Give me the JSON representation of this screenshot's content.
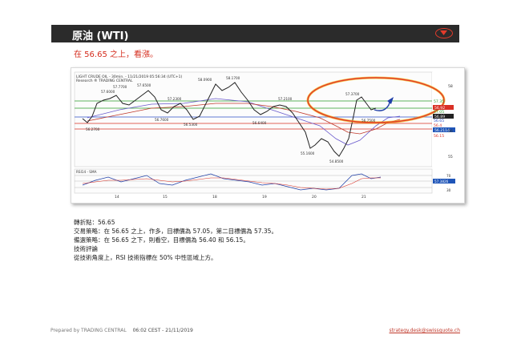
{
  "header": {
    "title": "原油 (WTI)",
    "toggle_icon": "chevron-down-icon"
  },
  "headline": "在 56.65 之上，看漲。",
  "chart": {
    "title_line1": "LIGHT CRUDE OIL - 30min. - 11/21/2019 05:56:34 (UTC+1)",
    "title_line2": "Research ® TRADING CENTRAL",
    "price_labels": [
      "57.7700",
      "57.6000",
      "57.6500",
      "58.0900",
      "58.1700",
      "57.2300",
      "57.2100",
      "56.7600",
      "56.5300",
      "56.6400",
      "57.3700",
      "56.7500",
      "56.2700",
      "55.1600",
      "54.8500"
    ],
    "right_axis_labels": [
      {
        "text": "58",
        "color": "#ffffff",
        "bg": ""
      },
      {
        "text": "57.35",
        "color": "#2e9b2e",
        "bg": ""
      },
      {
        "text": "57.05",
        "color": "#2e9b2e",
        "bg": ""
      },
      {
        "text": "56.92",
        "color": "#ffffff",
        "bg": "#d93025"
      },
      {
        "text": "56.89",
        "color": "#ffffff",
        "bg": "#222222"
      },
      {
        "text": "56.65",
        "color": "#2b4fc9",
        "bg": ""
      },
      {
        "text": "56.4",
        "color": "#d93025",
        "bg": ""
      },
      {
        "text": "56.2114",
        "color": "#ffffff",
        "bg": "#1f55b8"
      },
      {
        "text": "56.15",
        "color": "#d93025",
        "bg": ""
      },
      {
        "text": "56",
        "color": "#333",
        "bg": ""
      },
      {
        "text": "55",
        "color": "#333",
        "bg": ""
      }
    ],
    "rsi_title": "RSI14 - SMA",
    "rsi_axis": [
      "70",
      "57.3826",
      "50",
      "30"
    ],
    "x_labels": [
      "14",
      "15",
      "18",
      "19",
      "20",
      "21"
    ],
    "colors": {
      "resistance": "#2e9b2e",
      "pivot": "#2b4fc9",
      "support": "#d93025",
      "ellipse": "#e23b2b",
      "ellipse_glow": "#f4b400",
      "arrow": "#1f3fa8"
    }
  },
  "analysis": {
    "pivot": "轉折點：56.65",
    "strategy": "交易策略：在 56.65 之上，作多，目標價為 57.05，第二目標價為 57.35。",
    "alternative": "備選策略：在 56.65 之下，則看空，目標價為 56.40 和 56.15。",
    "comment_title": "技術評論",
    "comment": "從技術角度上，RSI 技術指標在 50% 中性區域上方。"
  },
  "footer": {
    "prepared": "Prepared by TRADING CENTRAL",
    "time": "06:02 CEST - 21/11/2019",
    "email": "strategy.desk@swissquote.ch"
  }
}
